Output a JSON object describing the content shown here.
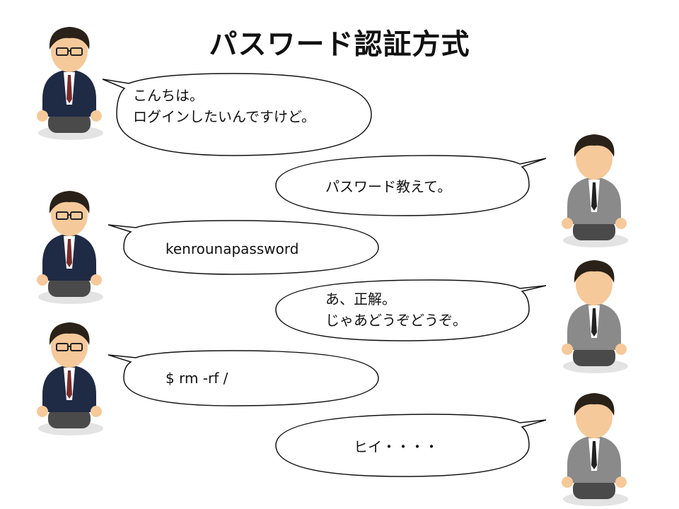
{
  "title": "パスワード認証方式",
  "messages": [
    {
      "speaker": "user",
      "text": "こんちは。\nログインしたいんですけど。"
    },
    {
      "speaker": "server",
      "text": "パスワード教えて。"
    },
    {
      "speaker": "user",
      "text": "kenrounapassword"
    },
    {
      "speaker": "server",
      "text": "あ、正解。\nじゃあどうぞどうぞ。"
    },
    {
      "speaker": "user",
      "text": "$ rm -rf /"
    },
    {
      "speaker": "server",
      "text": "ヒイ・・・・"
    }
  ],
  "colors": {
    "user_suit": "#1f2a44",
    "server_suit": "#8a8a8a",
    "tie_user": "#7a2a2a",
    "tie_server": "#222222",
    "skin": "#f6c99a",
    "hair": "#2a2118",
    "bubble_stroke": "#111111"
  }
}
